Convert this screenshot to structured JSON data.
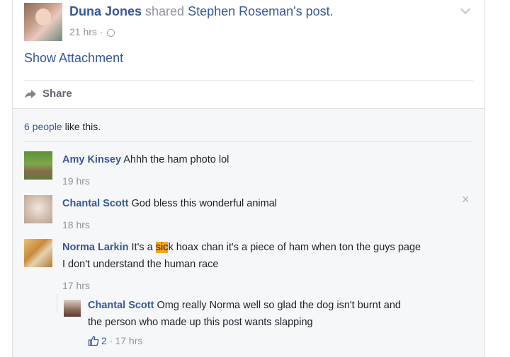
{
  "post": {
    "author": "Duna Jones",
    "action": " shared ",
    "shared_from": "Stephen Roseman's",
    "object": " post.",
    "time": "21 hrs",
    "time_sep": " · ",
    "attachment_link": "Show Attachment",
    "share_label": "Share"
  },
  "likes": {
    "count_link": "6 people",
    "suffix": " like this."
  },
  "comments": [
    {
      "name": "Amy Kinsey",
      "text": " Ahhh the ham photo lol",
      "time": "19 hrs"
    },
    {
      "name": "Chantal Scott",
      "text": " God bless this wonderful animal",
      "time": "18 hrs"
    },
    {
      "name": "Norma Larkin",
      "text_before": " It's a ",
      "text_highlight": "sic",
      "text_after": "k hoax chan it's a piece of ham when ton the guys page",
      "text_line2": "I don't understand the human race",
      "time": "17 hrs"
    }
  ],
  "reply": {
    "name": "Chantal Scott",
    "text": " Omg really Norma well so glad the dog isn't burnt and",
    "text_line2": "the person who made up this post wants slapping",
    "like_count": "2",
    "sep": " · ",
    "time": "17 hrs"
  },
  "icons": {
    "globe": "globe-icon",
    "chevron": "chevron-down-icon",
    "share": "share-arrow-icon",
    "close": "close-icon",
    "like": "thumbs-up-icon"
  },
  "close_glyph": "×",
  "colors": {
    "link": "#365899",
    "meta": "#90949c",
    "highlight": "#f5a623",
    "ufi_bg": "#f6f7f9"
  }
}
